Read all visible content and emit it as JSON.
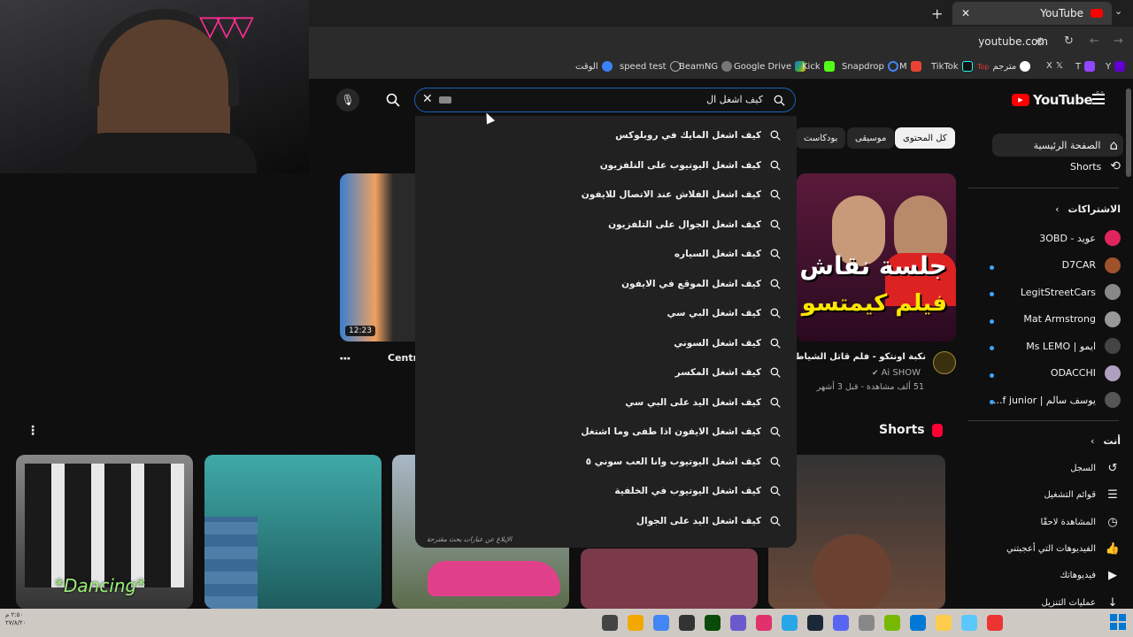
{
  "browser": {
    "tab_title": "YouTube",
    "url": "youtube.com",
    "bookmarks": [
      "الوقت",
      "speed test",
      "BeamNG",
      "Google Drive",
      "Kick",
      "Snapdrop",
      "M",
      "TikTok",
      "مترجم",
      "X",
      "T",
      "Y"
    ],
    "bookmark_colors": [
      "#3b82f6",
      "#aaa",
      "#888",
      "#1a73e8",
      "#53fc18",
      "#4285f4",
      "#ea4335",
      "#111",
      "#e33",
      "#666",
      "#9146ff",
      "#aaa"
    ]
  },
  "youtube": {
    "logo": "YouTube",
    "region": "SA",
    "search_query": "كيف اشغل ال",
    "suggestions": [
      "كيف اشغل المايك في روبلوكس",
      "كيف اشغل اليوتيوب على التلفزيون",
      "كيف اشغل الفلاش عند الاتصال للايفون",
      "كيف اشغل الجوال على التلفزيون",
      "كيف اشغل السياره",
      "كيف اشغل الموقع في الايفون",
      "كيف اشغل البي سي",
      "كيف اشغل السوني",
      "كيف اشغل المكسر",
      "كيف اشغل اليد على البي سي",
      "كيف اشغل الايفون اذا طفى وما اشتغل",
      "كيف اشغل اليوتيوب وانا العب سوني ٥",
      "كيف اشغل اليوتيوب في الخلفية",
      "كيف اشغل اليد على الجوال"
    ],
    "report_text": "الإبلاغ عن عبارات بحث مقترحة",
    "chips": [
      "كل المحتوى",
      "موسيقى",
      "بودكاست"
    ],
    "sidebar": {
      "home": "الصفحة الرئيسية",
      "shorts": "Shorts",
      "subscriptions_header": "الاشتراكات",
      "subscriptions": [
        "عويد - 3OBD",
        "D7CAR",
        "LegitStreetCars",
        "Mat Armstrong",
        "ايمو | Ms LEMO",
        "ODACCHI",
        "يوسف سالم | f junior..."
      ],
      "you_header": "أنت",
      "you_items": [
        "السجل",
        "قوائم التشغيل",
        "المشاهدة لاحقًا",
        "الفيديوهات التي أعجبتني",
        "فيديوهاتك",
        "عمليات التنزيل"
      ]
    },
    "video_right": {
      "title": "نكبة اونتكو - فلم قاتل الشياطين القعة",
      "channel": "Ai SHOW",
      "meta": "51 ألف مشاهدة - قبل 3 أشهر",
      "thumb_text_1": "جلسة نقاش",
      "thumb_text_2": "فيلم كيمتسو"
    },
    "video_left": {
      "duration": "12:23",
      "title_fragment": "Centr"
    },
    "shorts_header": "Shorts",
    "short_overlay": "*Dancing*"
  },
  "taskbar": {
    "time": "٢:٥٠ م",
    "date": "٢٧/٨/٢٠"
  }
}
